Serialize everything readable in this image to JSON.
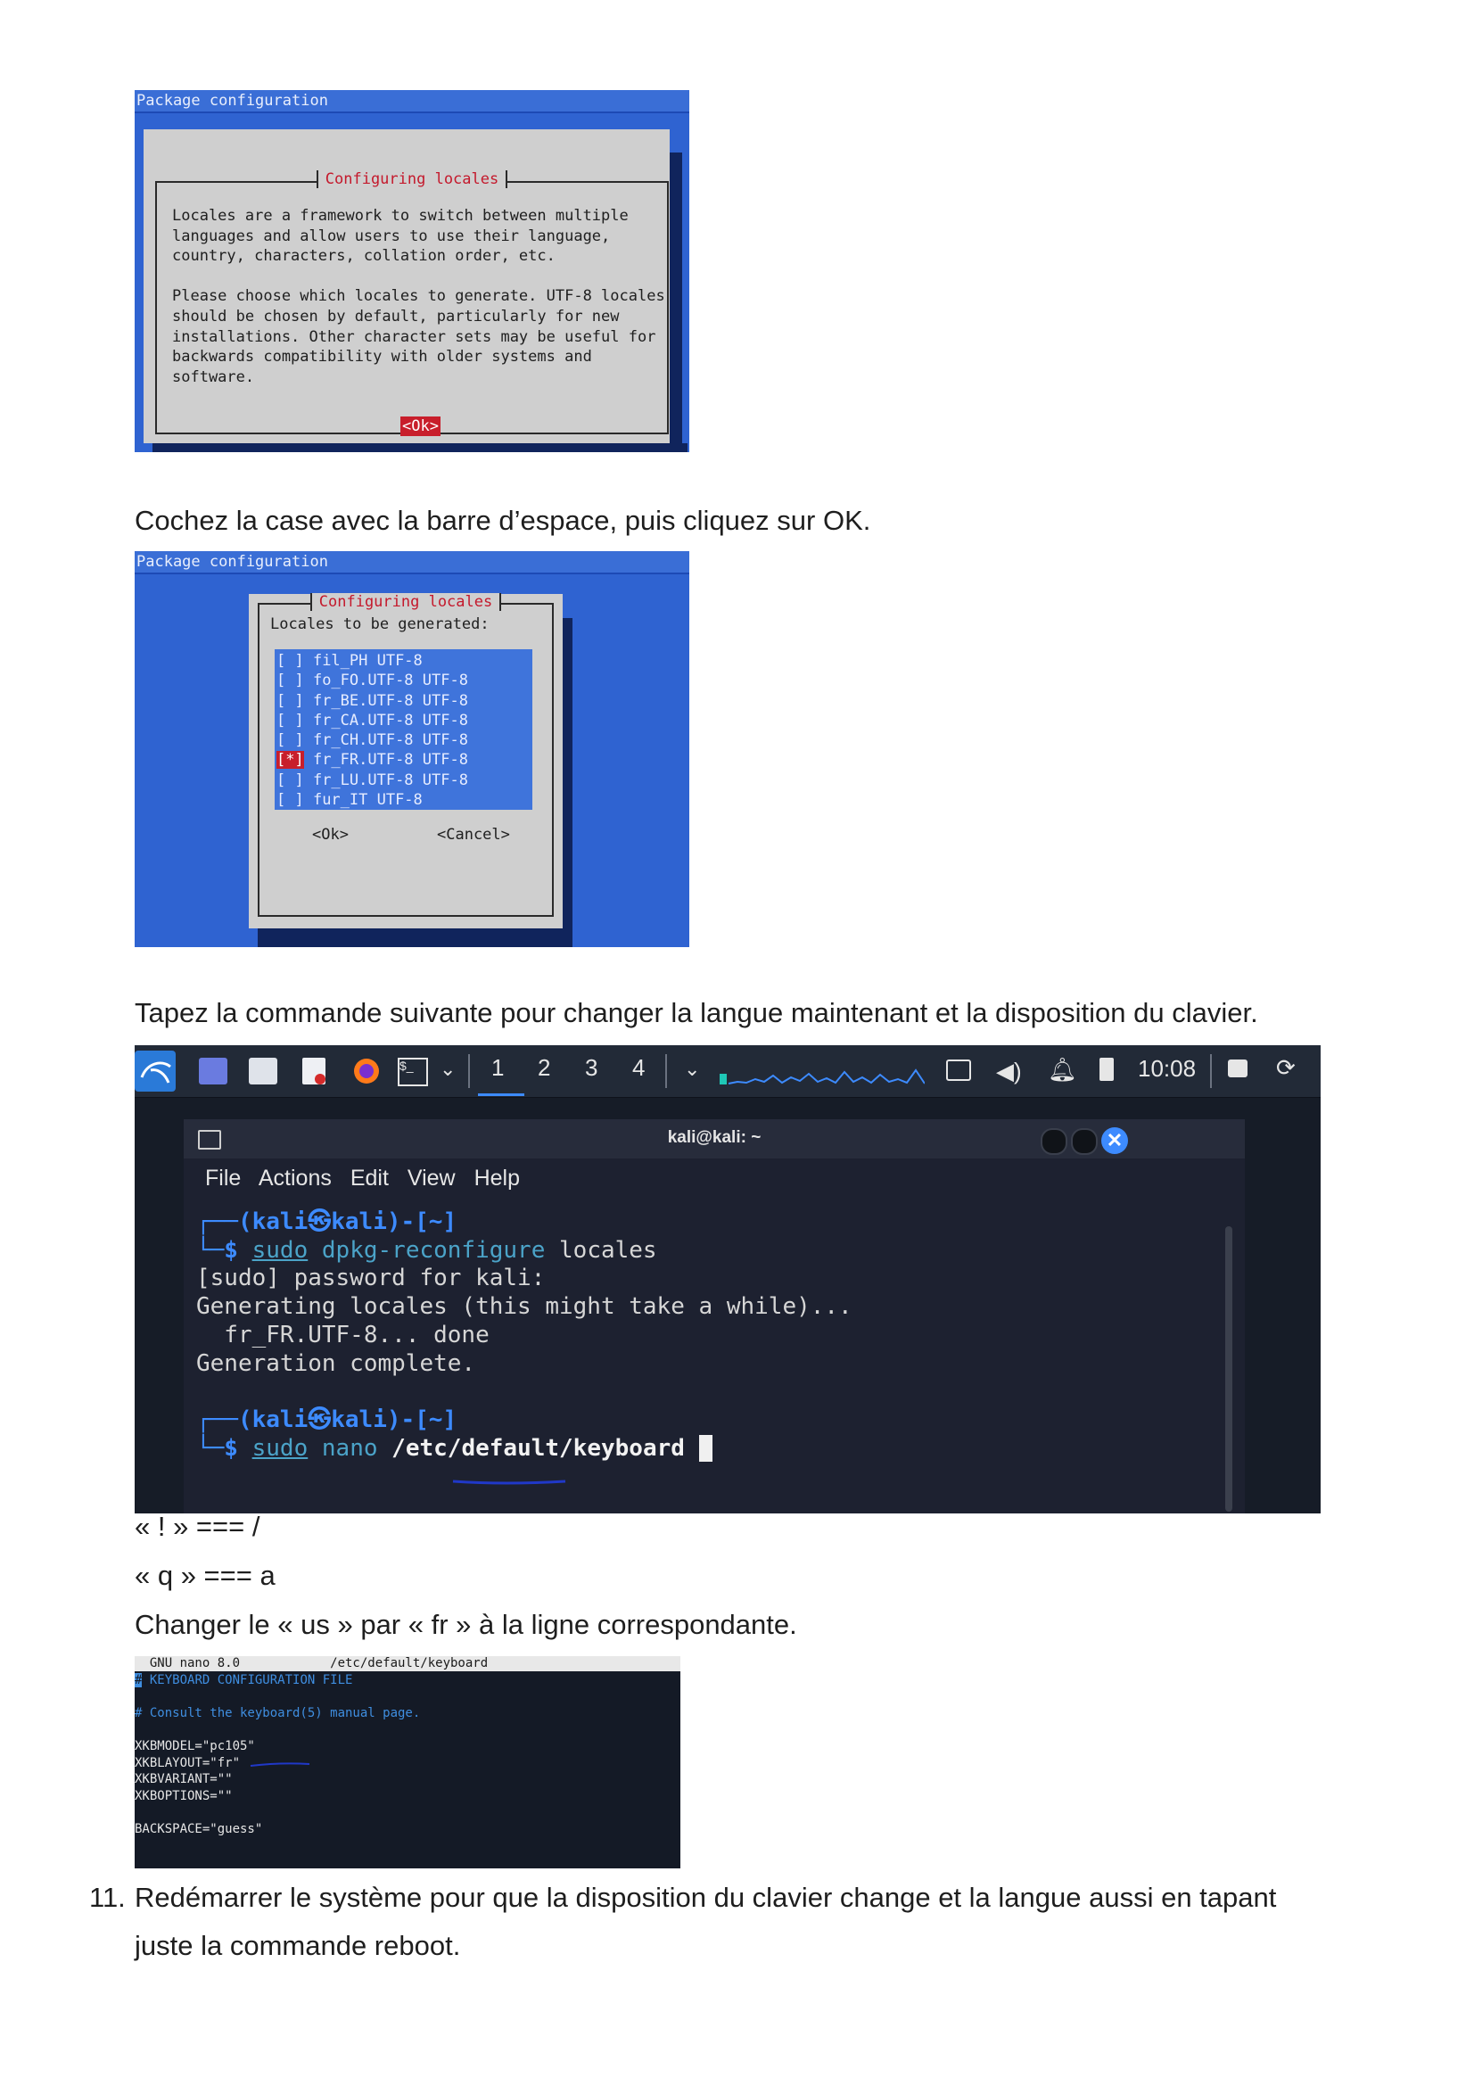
{
  "shot1": {
    "header": "Package configuration",
    "dialog_title": "Configuring locales",
    "text_lines": [
      "Locales are a framework to switch between multiple",
      "languages and allow users to use their language,",
      "country, characters, collation order, etc.",
      "",
      "Please choose which locales to generate. UTF-8 locales",
      "should be chosen by default, particularly for new",
      "installations. Other character sets may be useful for",
      "backwards compatibility with older systems and",
      "software."
    ],
    "ok_label": "<Ok>"
  },
  "caption1": "Cochez la case avec la barre d’espace, puis cliquez sur OK.",
  "shot2": {
    "header": "Package configuration",
    "dialog_title": "Configuring locales",
    "subtitle": "Locales to be generated:",
    "locales": [
      {
        "box": "[ ]",
        "name": " fil_PH UTF-8"
      },
      {
        "box": "[ ]",
        "name": " fo_FO.UTF-8 UTF-8"
      },
      {
        "box": "[ ]",
        "name": " fr_BE.UTF-8 UTF-8"
      },
      {
        "box": "[ ]",
        "name": " fr_CA.UTF-8 UTF-8"
      },
      {
        "box": "[ ]",
        "name": " fr_CH.UTF-8 UTF-8"
      },
      {
        "box": "[*]",
        "name": " fr_FR.UTF-8 UTF-8"
      },
      {
        "box": "[ ]",
        "name": " fr_LU.UTF-8 UTF-8"
      },
      {
        "box": "[ ]",
        "name": " fur_IT UTF-8"
      }
    ],
    "ok_label": "<Ok>",
    "cancel_label": "<Cancel>"
  },
  "caption2": "Tapez la commande suivante pour changer la langue maintenant et la disposition du clavier.",
  "shot3": {
    "workspaces": [
      "1",
      "2",
      "3",
      "4"
    ],
    "clock": "10:08",
    "window_title": "kali@kali: ~",
    "menu": [
      "File",
      "Actions",
      "Edit",
      "View",
      "Help"
    ],
    "prompt_user": "(kali㉿kali)-[~]",
    "cmd1_sudo": "sudo",
    "cmd1_rest": " dpkg-reconfigure",
    "cmd1_arg": " locales",
    "out1": "[sudo] password for kali:",
    "out2": "Generating locales (this might take a while)...",
    "out3": "  fr_FR.UTF-8... done",
    "out4": "Generation complete.",
    "cmd2_sudo": "sudo",
    "cmd2_rest": " nano",
    "cmd2_arg": " /etc/default/keyboard"
  },
  "note1": "« ! » === /",
  "note2": "« q » === a",
  "caption3": "Changer le « us » par « fr » à la ligne correspondante.",
  "shot4": {
    "nano_bar": "  GNU nano 8.0            /etc/default/keyboard",
    "line1": " KEYBOARD CONFIGURATION FILE",
    "line2": "# Consult the keyboard(5) manual page.",
    "line3": "XKBMODEL=\"pc105\"",
    "line4": "XKBLAYOUT=\"fr\"",
    "line5": "XKBVARIANT=\"\"",
    "line6": "XKBOPTIONS=\"\"",
    "line7": "BACKSPACE=\"guess\""
  },
  "item11": {
    "number": "11.",
    "line1": "Redémarrer le système pour que la disposition du clavier change et la langue aussi en tapant",
    "line2": "juste la commande reboot."
  }
}
